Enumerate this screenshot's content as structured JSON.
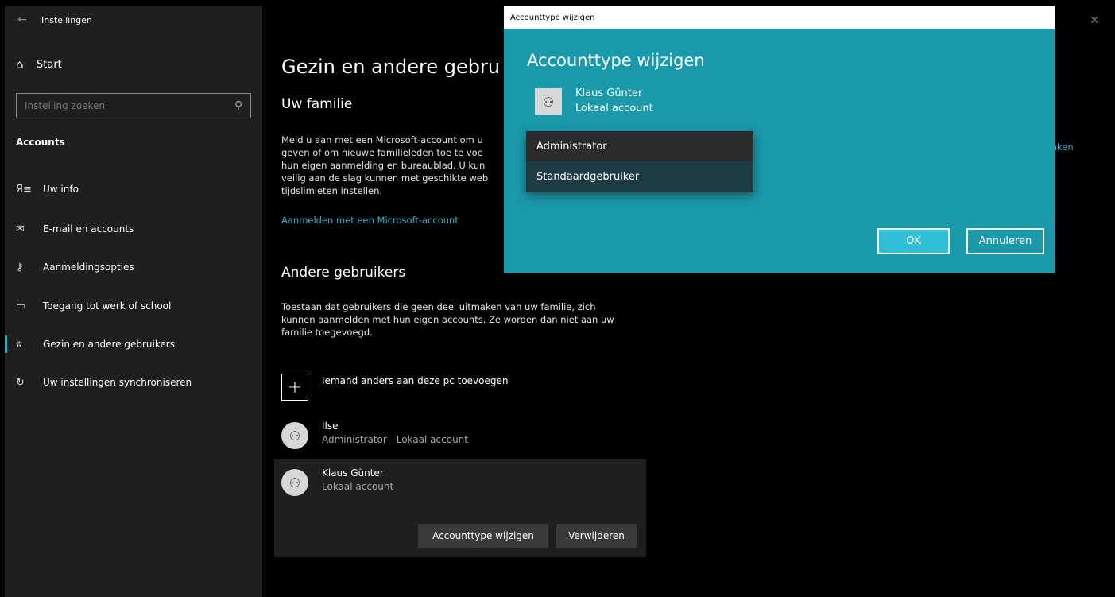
{
  "sidebar": {
    "app_title": "Instellingen",
    "start_label": "Start",
    "search_placeholder": "Instelling zoeken",
    "section_heading": "Accounts",
    "items": [
      {
        "label": "Uw info",
        "icon": "person-card-icon"
      },
      {
        "label": "E-mail en accounts",
        "icon": "mail-icon"
      },
      {
        "label": "Aanmeldingsopties",
        "icon": "key-icon"
      },
      {
        "label": "Toegang tot werk of school",
        "icon": "briefcase-icon"
      },
      {
        "label": "Gezin en andere gebruikers",
        "icon": "add-person-icon",
        "active": true
      },
      {
        "label": "Uw instellingen synchroniseren",
        "icon": "sync-icon"
      }
    ]
  },
  "main": {
    "page_title": "Gezin en andere gebru",
    "family_heading": "Uw familie",
    "family_text": [
      "Meld u aan met een Microsoft-account om u",
      "geven of om nieuwe familieleden toe te voe",
      "hun eigen aanmelding en bureaublad. U kun",
      "veilig aan de slag kunnen met geschikte web",
      "tijdslimieten instellen."
    ],
    "family_link": "Aanmelden met een Microsoft-account",
    "family_link_right": "aken",
    "others_heading": "Andere gebruikers",
    "others_text": [
      "Toestaan dat gebruikers die geen deel uitmaken van uw familie, zich",
      "kunnen aanmelden met hun eigen accounts. Ze worden dan niet aan uw",
      "familie toegevoegd."
    ],
    "add_user_label": "Iemand anders aan deze pc toevoegen",
    "users": [
      {
        "name": "Ilse",
        "type": "Administrator - Lokaal account"
      },
      {
        "name": "Klaus Günter",
        "type": "Lokaal account"
      }
    ],
    "change_type_button": "Accounttype wijzigen",
    "remove_button": "Verwijderen"
  },
  "dialog": {
    "window_title": "Accounttype wijzigen",
    "heading": "Accounttype wijzigen",
    "user_name": "Klaus Günter",
    "user_type": "Lokaal account",
    "options": [
      "Administrator",
      "Standaardgebruiker"
    ],
    "selected_option": "Standaardgebruiker",
    "ok_label": "OK",
    "cancel_label": "Annuleren"
  },
  "colors": {
    "accent": "#2fb0c8",
    "dialog_bg": "#1a99ab",
    "sidebar_bg": "#1f1f1f"
  }
}
